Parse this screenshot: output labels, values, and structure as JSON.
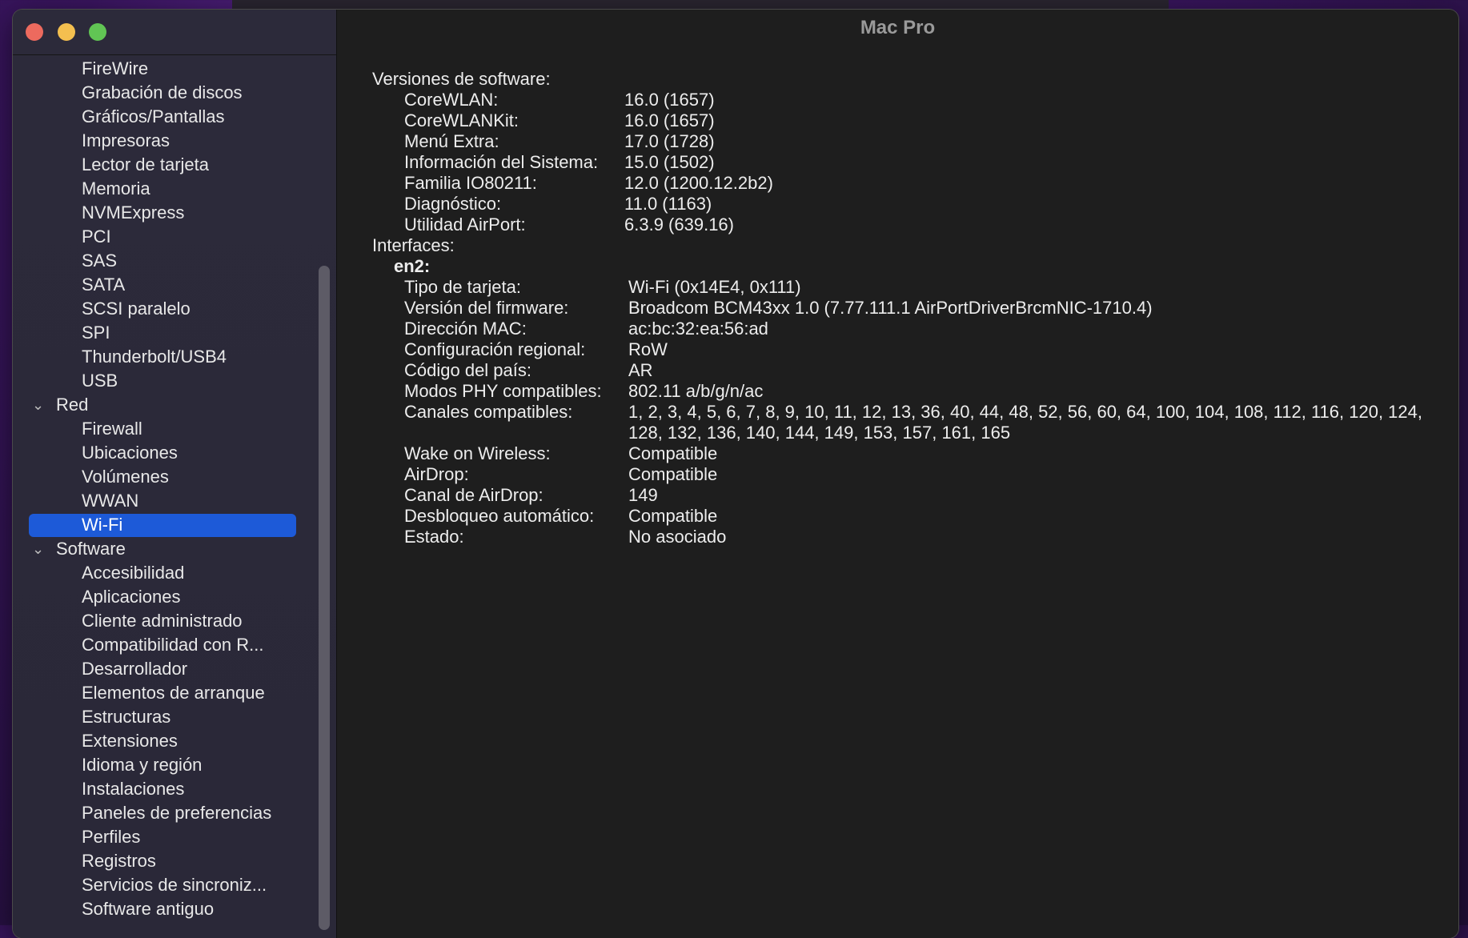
{
  "window": {
    "title": "Mac Pro"
  },
  "sidebar": {
    "items": [
      {
        "label": "FireWire",
        "kind": "child"
      },
      {
        "label": "Grabación de discos",
        "kind": "child"
      },
      {
        "label": "Gráficos/Pantallas",
        "kind": "child"
      },
      {
        "label": "Impresoras",
        "kind": "child"
      },
      {
        "label": "Lector de tarjeta",
        "kind": "child"
      },
      {
        "label": "Memoria",
        "kind": "child"
      },
      {
        "label": "NVMExpress",
        "kind": "child"
      },
      {
        "label": "PCI",
        "kind": "child"
      },
      {
        "label": "SAS",
        "kind": "child"
      },
      {
        "label": "SATA",
        "kind": "child"
      },
      {
        "label": "SCSI paralelo",
        "kind": "child"
      },
      {
        "label": "SPI",
        "kind": "child"
      },
      {
        "label": "Thunderbolt/USB4",
        "kind": "child"
      },
      {
        "label": "USB",
        "kind": "child"
      },
      {
        "label": "Red",
        "kind": "group"
      },
      {
        "label": "Firewall",
        "kind": "child"
      },
      {
        "label": "Ubicaciones",
        "kind": "child"
      },
      {
        "label": "Volúmenes",
        "kind": "child"
      },
      {
        "label": "WWAN",
        "kind": "child"
      },
      {
        "label": "Wi-Fi",
        "kind": "child",
        "selected": true
      },
      {
        "label": "Software",
        "kind": "group"
      },
      {
        "label": "Accesibilidad",
        "kind": "child"
      },
      {
        "label": "Aplicaciones",
        "kind": "child"
      },
      {
        "label": "Cliente administrado",
        "kind": "child"
      },
      {
        "label": "Compatibilidad con R...",
        "kind": "child"
      },
      {
        "label": "Desarrollador",
        "kind": "child"
      },
      {
        "label": "Elementos de arranque",
        "kind": "child"
      },
      {
        "label": "Estructuras",
        "kind": "child"
      },
      {
        "label": "Extensiones",
        "kind": "child"
      },
      {
        "label": "Idioma y región",
        "kind": "child"
      },
      {
        "label": "Instalaciones",
        "kind": "child"
      },
      {
        "label": "Paneles de preferencias",
        "kind": "child"
      },
      {
        "label": "Perfiles",
        "kind": "child"
      },
      {
        "label": "Registros",
        "kind": "child"
      },
      {
        "label": "Servicios de sincroniz...",
        "kind": "child"
      },
      {
        "label": "Software antiguo",
        "kind": "child"
      }
    ]
  },
  "content": {
    "software_heading": "Versiones de software:",
    "software": [
      {
        "label": "CoreWLAN:",
        "value": "16.0 (1657)"
      },
      {
        "label": "CoreWLANKit:",
        "value": "16.0 (1657)"
      },
      {
        "label": "Menú Extra:",
        "value": "17.0 (1728)"
      },
      {
        "label": "Información del Sistema:",
        "value": "15.0 (1502)"
      },
      {
        "label": "Familia IO80211:",
        "value": "12.0 (1200.12.2b2)"
      },
      {
        "label": "Diagnóstico:",
        "value": "11.0 (1163)"
      },
      {
        "label": "Utilidad AirPort:",
        "value": "6.3.9 (639.16)"
      }
    ],
    "interfaces_heading": "Interfaces:",
    "interface_name": "en2:",
    "interface": [
      {
        "label": "Tipo de tarjeta:",
        "value": "Wi-Fi  (0x14E4, 0x111)"
      },
      {
        "label": "Versión del firmware:",
        "value": "Broadcom BCM43xx 1.0 (7.77.111.1 AirPortDriverBrcmNIC-1710.4)"
      },
      {
        "label": "Dirección MAC:",
        "value": "ac:bc:32:ea:56:ad"
      },
      {
        "label": "Configuración regional:",
        "value": "RoW"
      },
      {
        "label": "Código del país:",
        "value": "AR"
      },
      {
        "label": "Modos PHY compatibles:",
        "value": "802.11 a/b/g/n/ac"
      },
      {
        "label": "Canales compatibles:",
        "value": "1, 2, 3, 4, 5, 6, 7, 8, 9, 10, 11, 12, 13, 36, 40, 44, 48, 52, 56, 60, 64, 100, 104, 108, 112, 116, 120, 124, 128, 132, 136, 140, 144, 149, 153, 157, 161, 165",
        "tall": true
      },
      {
        "label": "Wake on Wireless:",
        "value": "Compatible"
      },
      {
        "label": "AirDrop:",
        "value": "Compatible"
      },
      {
        "label": "Canal de AirDrop:",
        "value": "149"
      },
      {
        "label": "Desbloqueo automático:",
        "value": "Compatible"
      },
      {
        "label": "Estado:",
        "value": "No asociado"
      }
    ]
  },
  "colors": {
    "selection": "#1d5ad8",
    "close": "#ed6a5e",
    "minimize": "#f4bf4f",
    "zoom": "#61c554"
  }
}
